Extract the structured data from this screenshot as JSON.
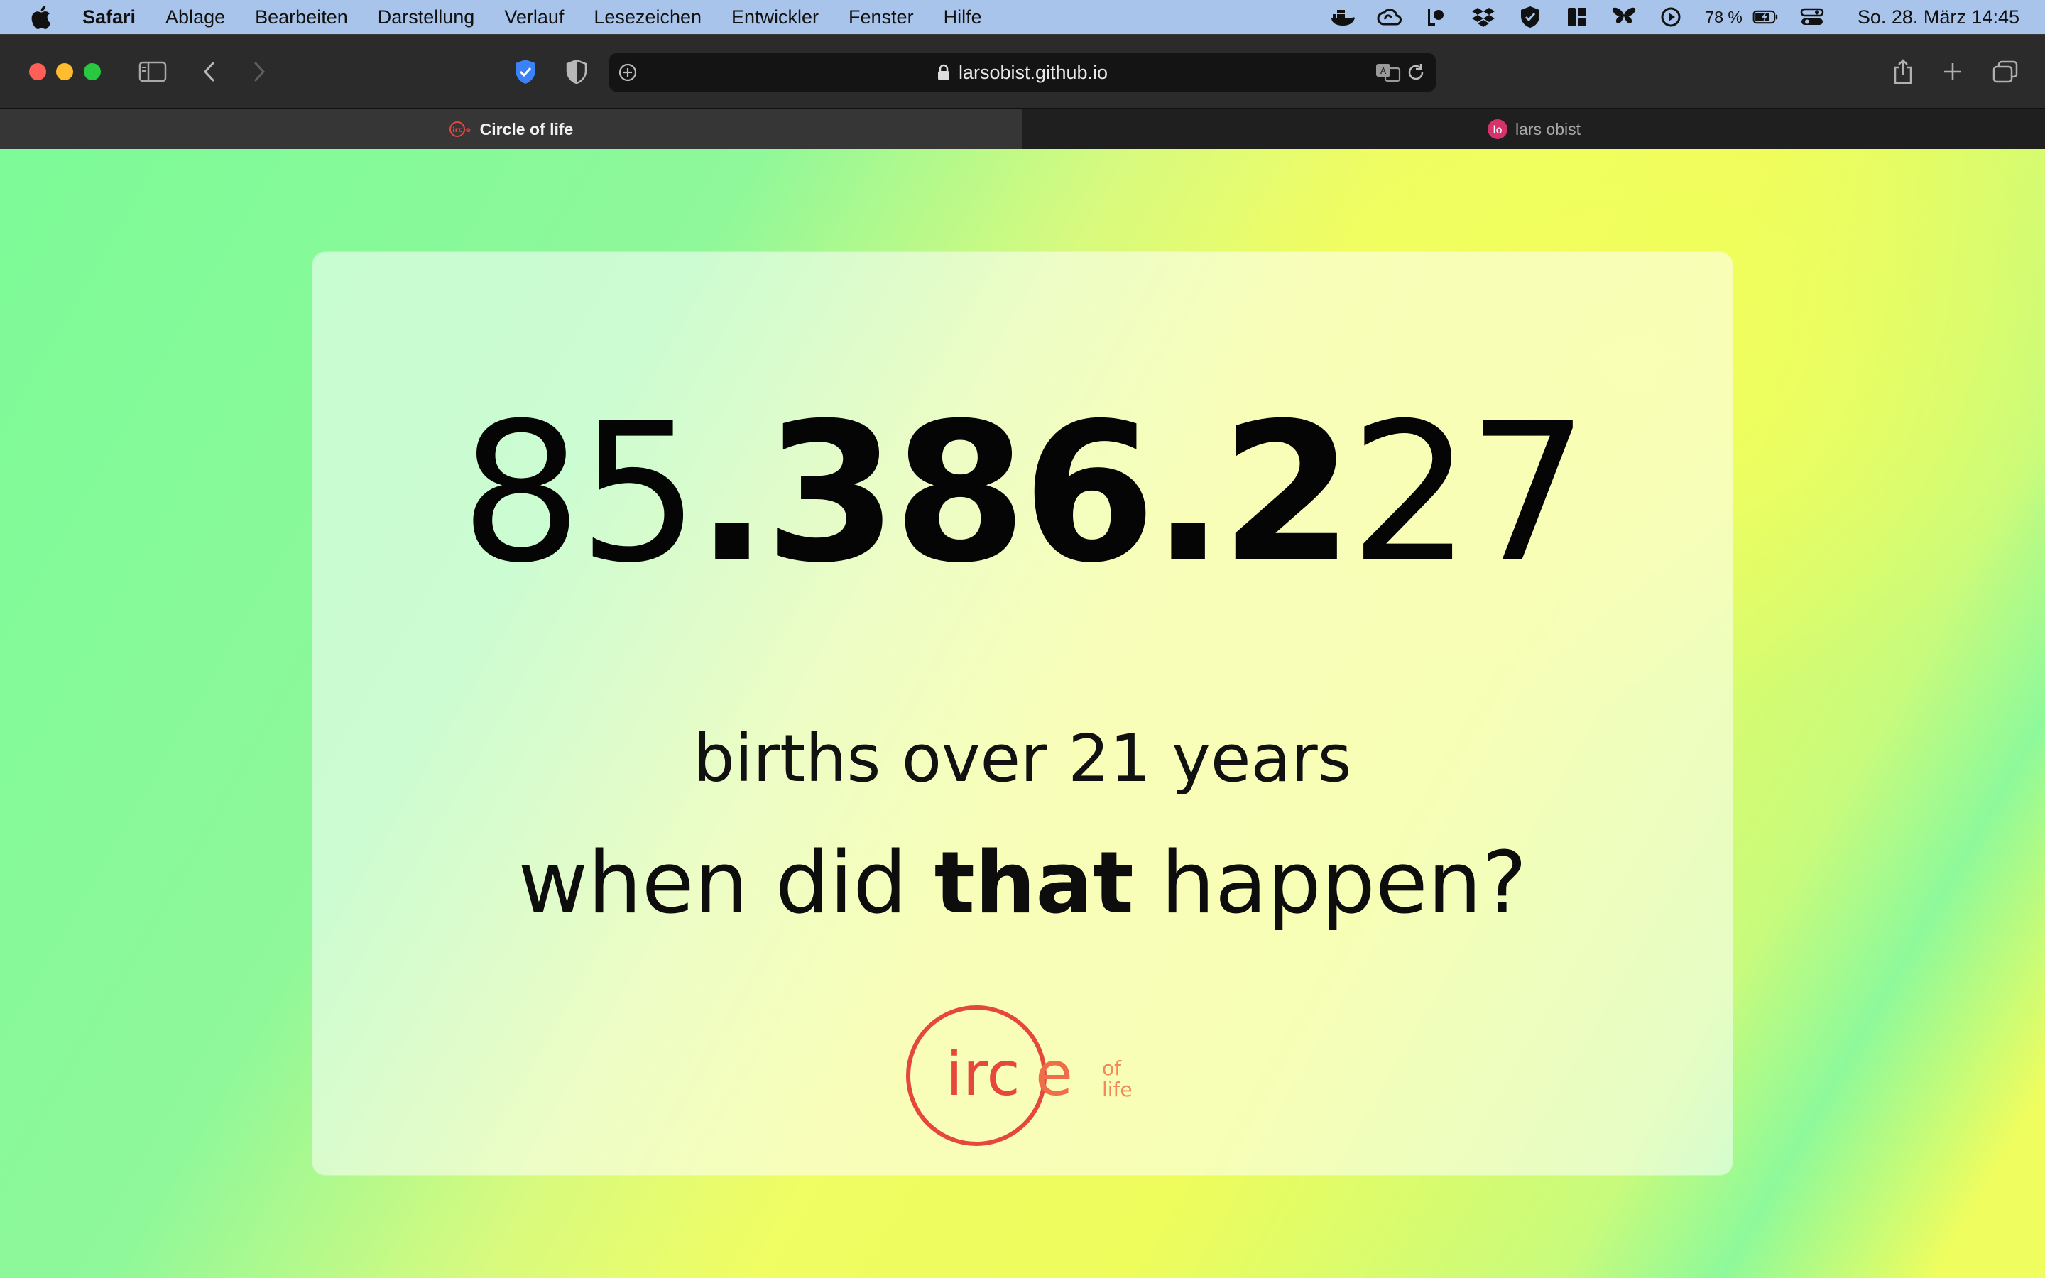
{
  "menubar": {
    "app_name": "Safari",
    "items": [
      "Ablage",
      "Bearbeiten",
      "Darstellung",
      "Verlauf",
      "Lesezeichen",
      "Entwickler",
      "Fenster",
      "Hilfe"
    ],
    "battery_percent": "78 %",
    "clock": "So. 28. März  14:45",
    "status_icons": [
      "docker-icon",
      "creative-cloud-icon",
      "notch-app-icon",
      "dropbox-icon",
      "shield-check-icon",
      "layout-icon",
      "butterfly-icon",
      "play-circle-icon",
      "battery-icon",
      "control-center-icon"
    ]
  },
  "toolbar": {
    "url": "larsobist.github.io"
  },
  "tabs": [
    {
      "title": "Circle of life",
      "active": true
    },
    {
      "title": "lars obist",
      "active": false
    }
  ],
  "page": {
    "counter_parts": [
      "8",
      "5",
      ".",
      "386",
      ".",
      "2",
      "2",
      "7"
    ],
    "subtitle": "births over 21 years",
    "question_before": "when did ",
    "question_bold": "that",
    "question_after": " happen?",
    "logo": {
      "word": "irc",
      "word_end": "e",
      "small_top": "of",
      "small_bottom": "life",
      "color": "#e5473c",
      "small_color": "#f08a5a"
    }
  },
  "colors": {
    "background_green": "#7dfb98",
    "background_yellow": "#f0fd63",
    "accent_red": "#e5473c"
  }
}
